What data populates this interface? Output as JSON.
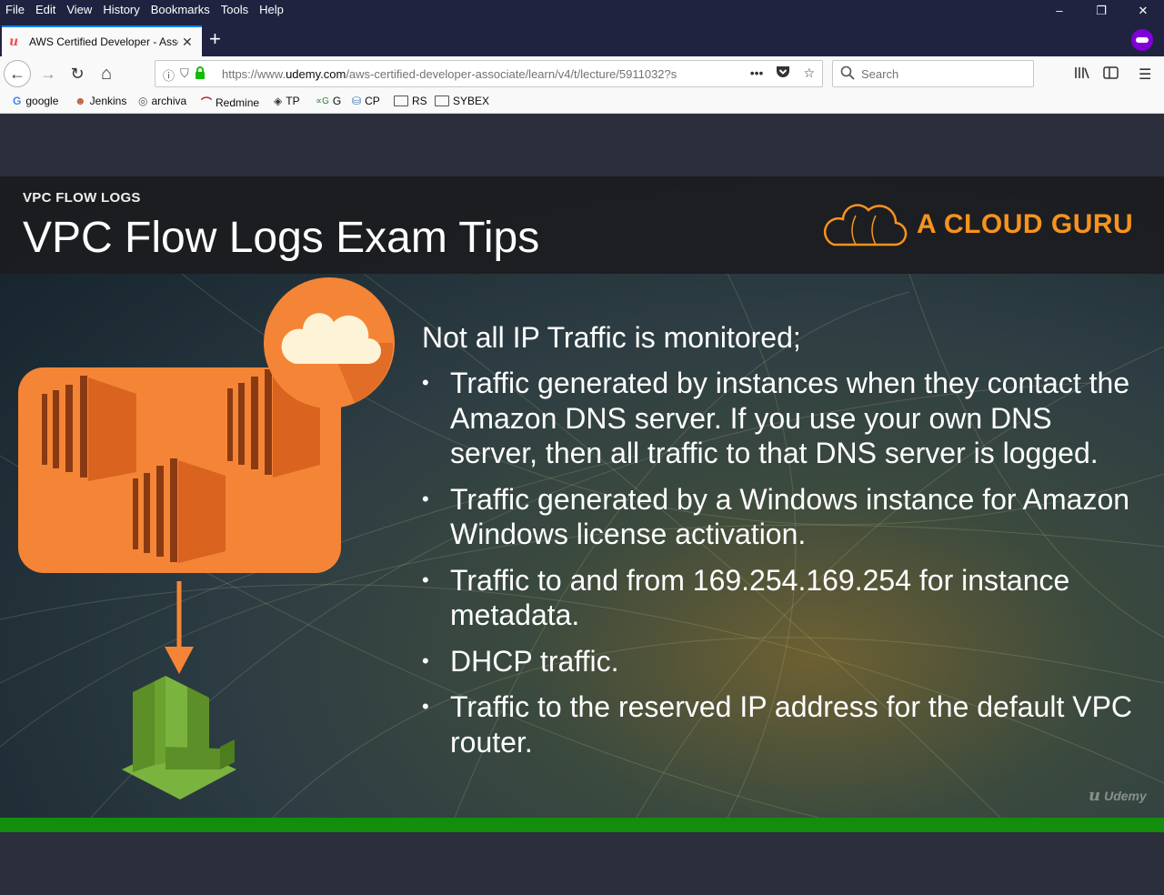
{
  "browser": {
    "menu": [
      "File",
      "Edit",
      "View",
      "History",
      "Bookmarks",
      "Tools",
      "Help"
    ],
    "window_controls": {
      "minimize": "–",
      "restore": "❐",
      "close": "✕"
    },
    "tab": {
      "title": "AWS Certified Developer - Asso",
      "favicon": "udemy-icon",
      "close_icon": "✕"
    },
    "new_tab_icon": "+",
    "nav": {
      "back_icon": "←",
      "forward_icon": "→",
      "reload_icon": "↻",
      "home_icon": "⌂"
    },
    "url": {
      "prefix": "https://www.",
      "domain": "udemy.com",
      "path": "/aws-certified-developer-associate/learn/v4/t/lecture/5911032?s",
      "info_icon": "ⓘ",
      "shield_icon": "⛉",
      "lock_icon": "🔒",
      "page_actions_icon": "•••",
      "pocket_icon": "◘",
      "bookmark_star_icon": "☆"
    },
    "search": {
      "placeholder": "Search",
      "icon": "⚲"
    },
    "right_tools": {
      "library_icon": "|||\\",
      "sidebar_icon": "▥",
      "menu_icon": "☰"
    },
    "bookmarks": [
      {
        "label": "google",
        "icon": "G",
        "color": "#4285f4"
      },
      {
        "label": "Jenkins",
        "icon": "☻",
        "color": "#c0392b"
      },
      {
        "label": "archiva",
        "icon": "◎",
        "color": "#555555"
      },
      {
        "label": "Redmine",
        "icon": "⌒",
        "color": "#b32024"
      },
      {
        "label": "TP",
        "icon": "◈",
        "color": "#333333"
      },
      {
        "label": "G",
        "icon": "∝",
        "color": "#2e7d32"
      },
      {
        "label": "CP",
        "icon": "⛁",
        "color": "#3a6ea5"
      },
      {
        "label": "RS",
        "icon": "folder"
      },
      {
        "label": "SYBEX",
        "icon": "folder"
      }
    ]
  },
  "slide": {
    "kicker": "VPC FLOW LOGS",
    "title": "VPC Flow Logs Exam Tips",
    "brand": "A CLOUD GURU",
    "lead": "Not all IP Traffic is monitored;",
    "bullets": [
      "Traffic generated by instances when they contact the Amazon DNS server. If you use your own DNS server, then all traffic to that DNS server is logged.",
      "Traffic generated by a Windows instance for Amazon Windows license activation.",
      "Traffic to and from 169.254.169.254 for instance metadata.",
      "DHCP traffic.",
      "Traffic to the reserved IP address for the default VPC router."
    ],
    "watermark": "Udemy",
    "colors": {
      "orange": "#f58536",
      "dark_orange": "#d9631f",
      "green": "#6ca22f",
      "progress": "#138d0c"
    }
  }
}
